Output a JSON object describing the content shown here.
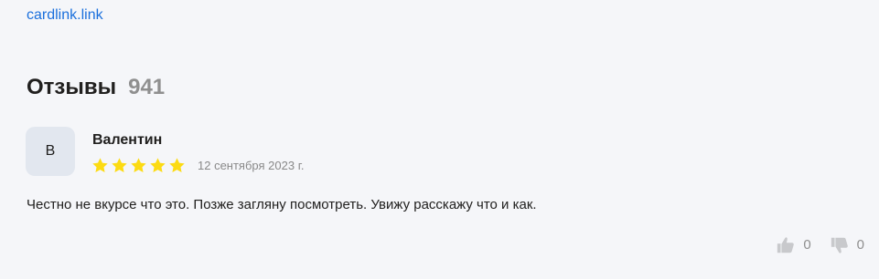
{
  "link": {
    "text": "cardlink.link"
  },
  "reviews": {
    "title": "Отзывы",
    "count": "941"
  },
  "review": {
    "avatar_letter": "В",
    "author": "Валентин",
    "rating": 5,
    "rating_max": 5,
    "date": "12 сентября 2023 г.",
    "text": "Честно не вкурсе что это. Позже загляну посмотреть. Увижу расскажу что и как.",
    "likes": "0",
    "dislikes": "0"
  },
  "colors": {
    "link": "#1a6fdc",
    "star": "#fcdb13",
    "avatar_bg": "#e2e7ef",
    "muted": "#8f8f8f",
    "background": "#f5f6f9"
  },
  "icons": {
    "star": "star-icon",
    "like": "thumbs-up-icon",
    "dislike": "thumbs-down-icon"
  }
}
